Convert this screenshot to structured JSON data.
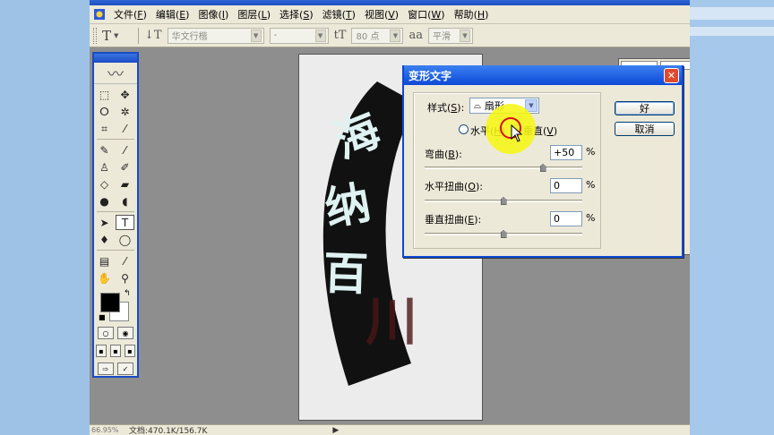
{
  "menu": {
    "items": [
      {
        "label": "文件",
        "key": "F"
      },
      {
        "label": "编辑",
        "key": "E"
      },
      {
        "label": "图像",
        "key": "I"
      },
      {
        "label": "图层",
        "key": "L"
      },
      {
        "label": "选择",
        "key": "S"
      },
      {
        "label": "滤镜",
        "key": "T"
      },
      {
        "label": "视图",
        "key": "V"
      },
      {
        "label": "窗口",
        "key": "W"
      },
      {
        "label": "帮助",
        "key": "H"
      }
    ]
  },
  "options": {
    "tool_glyph": "T",
    "orient_glyph": "↓T",
    "font_family": "华文行楷",
    "font_style": "-",
    "size_glyph": "tT",
    "font_size": "80 点",
    "aa_glyph": "aa",
    "antialias": "平滑"
  },
  "canvas": {
    "text_chars": [
      "海",
      "纳",
      "百",
      "川"
    ],
    "arc_color": "#111111",
    "text_color": "#dff2f2",
    "faded_color": "#4a1515"
  },
  "dialog": {
    "title": "变形文字",
    "style_label": "样式",
    "style_key": "S",
    "style_icon": "arc-icon",
    "style_value": "扇形",
    "horizontal_label": "水平",
    "horizontal_key": "H",
    "vertical_label": "垂直",
    "vertical_key": "V",
    "selected_orientation": "vertical",
    "bend_label": "弯曲",
    "bend_key": "B",
    "bend_value": "+50",
    "bend_fraction": 0.75,
    "hdist_label": "水平扭曲",
    "hdist_key": "O",
    "hdist_value": "0",
    "hdist_fraction": 0.5,
    "vdist_label": "垂直扭曲",
    "vdist_key": "E",
    "vdist_value": "0",
    "vdist_fraction": 0.5,
    "percent": "%",
    "ok_label": "好",
    "cancel_label": "取消"
  },
  "status": {
    "zoom": "66.95%",
    "doc_size": "文档:470.1K/156.7K",
    "arrow": "▶"
  },
  "colors": {
    "desktop": "#9dc2e6",
    "workspace": "#8e8e8e",
    "title_blue": "#0d49d6",
    "highlight": "#f6f614",
    "click_ring": "#d41111"
  }
}
